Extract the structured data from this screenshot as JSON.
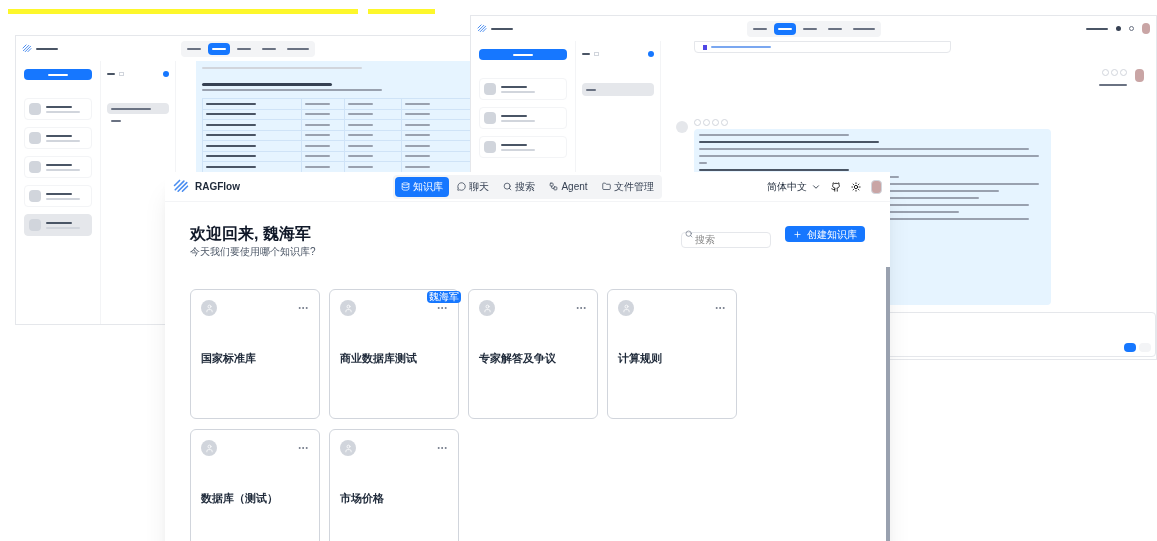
{
  "front_window": {
    "logo": "RAGFlow",
    "nav": [
      {
        "label": "知识库",
        "selected": true
      },
      {
        "label": "聊天",
        "selected": false
      },
      {
        "label": "搜索",
        "selected": false
      },
      {
        "label": "Agent",
        "selected": false
      },
      {
        "label": "文件管理",
        "selected": false
      }
    ],
    "language": "简体中文",
    "greeting": "欢迎回来, 魏海军",
    "subtitle": "今天我们要使用哪个知识库?",
    "search_placeholder": "搜索",
    "create_button": "创建知识库",
    "knowledge_bases": [
      {
        "title": "国家标准库"
      },
      {
        "title": "商业数据库测试",
        "badge": "魏海军"
      },
      {
        "title": "专家解答及争议"
      },
      {
        "title": "计算规则"
      },
      {
        "title": "数据库（测试）"
      },
      {
        "title": "市场价格"
      }
    ]
  }
}
